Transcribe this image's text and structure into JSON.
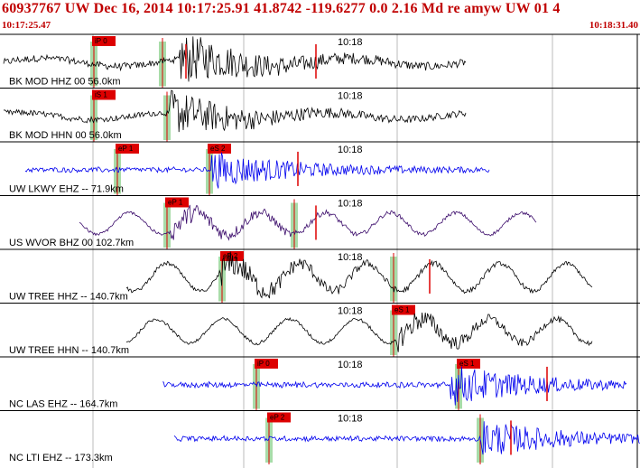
{
  "header": {
    "title": "60937767 UW Dec 16, 2014 10:17:25.91   41.8742 -119.6277  0.0 2.16 Md re amyw UW 01   4",
    "start_time": "10:17:25.47",
    "end_time": "10:18:31.40"
  },
  "colors": {
    "accent": "#c00000",
    "trace_black": "#000000",
    "trace_blue": "#0000ee",
    "trace_purple": "#3a0a6a",
    "pick_window": "#a8dca8",
    "pick_mark": "#dd0000"
  },
  "traces": [
    {
      "label": "BK MOD HHZ 00 56.0km",
      "minute_label": "10:18",
      "color": "black",
      "picks": [
        {
          "label": "iP 0",
          "window": 0.14
        },
        {
          "label": "",
          "window": 0.25
        }
      ]
    },
    {
      "label": "BK MOD HHN 00 56.0km",
      "minute_label": "10:18",
      "color": "black",
      "picks": [
        {
          "label": "iS 1",
          "window": 0.14
        },
        {
          "label": "",
          "window": 0.25
        }
      ]
    },
    {
      "label": "UW LKWY EHZ -- 71.9km",
      "minute_label": "10:18",
      "color": "blue",
      "picks": [
        {
          "label": "eP 1",
          "window": 0.18
        },
        {
          "label": "eS 2",
          "window": 0.31
        }
      ]
    },
    {
      "label": "US WVOR BHZ 00 102.7km",
      "minute_label": "10:18",
      "color": "purple",
      "picks": [
        {
          "label": "eP 1",
          "window": 0.25
        },
        {
          "label": "",
          "window": 0.45
        }
      ]
    },
    {
      "label": "UW TREE HHZ -- 140.7km",
      "minute_label": "10:18",
      "color": "black",
      "picks": [
        {
          "label": "eP 2",
          "window": 0.33
        },
        {
          "label": "",
          "window": 0.61
        }
      ]
    },
    {
      "label": "UW TREE HHN -- 140.7km",
      "minute_label": "10:18",
      "color": "black",
      "picks": [
        {
          "label": "eS 1",
          "window": 0.61
        }
      ]
    },
    {
      "label": "NC LAS EHZ -- 164.7km",
      "minute_label": "10:18",
      "color": "blue",
      "picks": [
        {
          "label": "iP 0",
          "window": 0.38
        },
        {
          "label": "eS 1",
          "window": 0.71
        }
      ]
    },
    {
      "label": "NC LTI EHZ -- 173.3km",
      "minute_label": "10:18",
      "color": "blue",
      "picks": [
        {
          "label": "eP 2",
          "window": 0.41
        },
        {
          "label": "",
          "window": 0.75
        }
      ]
    }
  ]
}
